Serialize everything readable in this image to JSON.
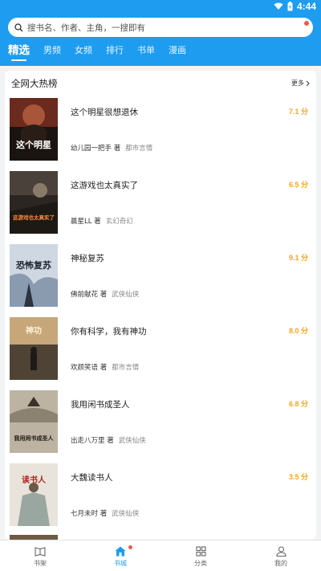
{
  "status": {
    "time": "4:44"
  },
  "search": {
    "placeholder": "搜书名、作者、主角，一搜即有"
  },
  "tabs": [
    {
      "label": "精选"
    },
    {
      "label": "男频"
    },
    {
      "label": "女频"
    },
    {
      "label": "排行"
    },
    {
      "label": "书单"
    },
    {
      "label": "漫画"
    }
  ],
  "ranking": {
    "title": "全网大热榜",
    "more_label": "更多",
    "books": [
      {
        "title": "这个明星很想退休",
        "author": "幼儿园一把手 著",
        "genre": "都市言情",
        "score": "7.1 分",
        "cover_text": "这个明星",
        "cover_theme": "#1a1410"
      },
      {
        "title": "这游戏也太真实了",
        "author": "晨星LL 著",
        "genre": "玄幻奇幻",
        "score": "6.5 分",
        "cover_text": "这游戏也太真实了",
        "cover_theme": "#2c2622"
      },
      {
        "title": "神秘复苏",
        "author": "佛前献花 著",
        "genre": "武侠仙侠",
        "score": "9.1 分",
        "cover_text": "恐怖复苏",
        "cover_theme": "#cfd7e2"
      },
      {
        "title": "你有科学，我有神功",
        "author": "欢颜笑语 著",
        "genre": "都市言情",
        "score": "8.0 分",
        "cover_text": "神功",
        "cover_theme": "#7a6a55"
      },
      {
        "title": "我用闲书成圣人",
        "author": "出走八万里 著",
        "genre": "武侠仙侠",
        "score": "6.8 分",
        "cover_text": "我用闲书成圣人",
        "cover_theme": "#bcb3a2"
      },
      {
        "title": "大魏读书人",
        "author": "七月未时 著",
        "genre": "武侠仙侠",
        "score": "3.5 分",
        "cover_text": "读书人",
        "cover_theme": "#e8e4dc"
      }
    ]
  },
  "bottom_nav": [
    {
      "label": "书架",
      "icon": "book-open-icon",
      "active": false
    },
    {
      "label": "书城",
      "icon": "home-icon",
      "active": true
    },
    {
      "label": "分类",
      "icon": "grid-icon",
      "active": false
    },
    {
      "label": "我的",
      "icon": "person-icon",
      "active": false
    }
  ],
  "colors": {
    "brand": "#1e9cf0",
    "score": "#f5a623",
    "badge": "#f05a46"
  }
}
